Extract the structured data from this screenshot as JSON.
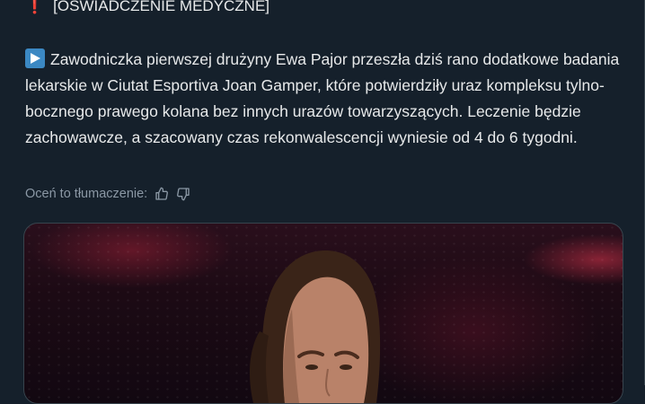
{
  "tweet": {
    "headline": "[OŚWIADCZENIE MEDYCZNE]",
    "headline_icon": "exclamation-mark",
    "body_icon": "play-button",
    "body": "Zawodniczka pierwszej drużyny Ewa Pajor przeszła dziś rano dodatkowe badania lekarskie w Ciutat Esportiva Joan Gamper, które potwierdziły uraz kompleksu tylno-bocznego prawego kolana bez innych urazów towarzyszących. Leczenie będzie zachowawcze, a szacowany czas rekonwalescencji wyniesie od 4 do 6 tygodni.",
    "rate_label": "Oceń to tłumaczenie:"
  },
  "colors": {
    "background": "#15202b",
    "text": "#e7e9ea",
    "muted": "#8b98a5",
    "accent_red": "#f4212e",
    "play_blue": "#3b88c3"
  }
}
